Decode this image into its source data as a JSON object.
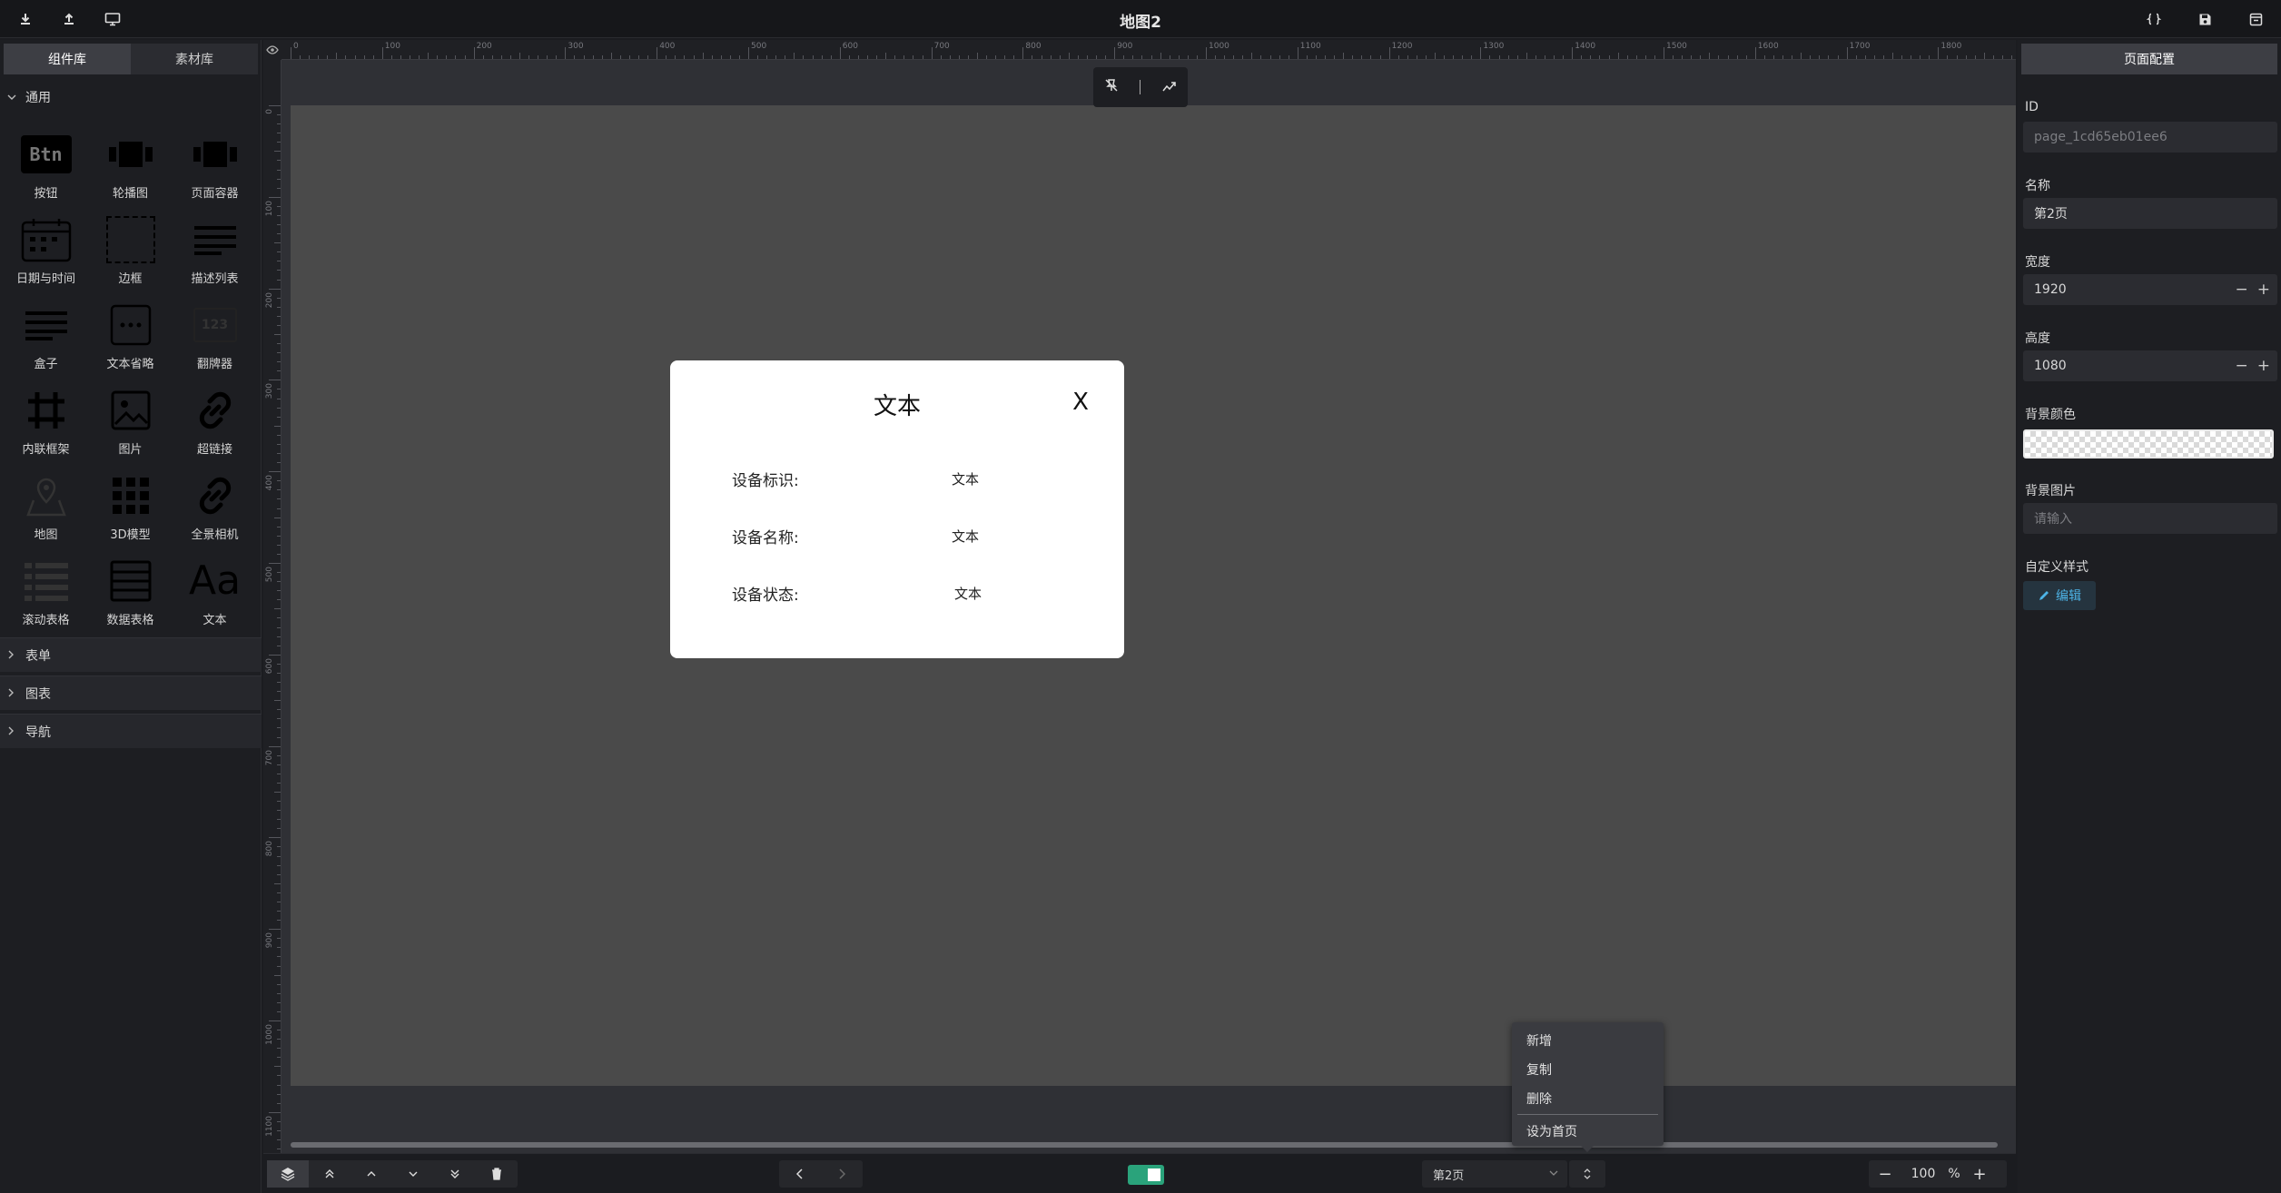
{
  "window": {
    "title": "地图2"
  },
  "left_panel": {
    "tabs": [
      {
        "label": "组件库"
      },
      {
        "label": "素材库"
      }
    ],
    "sections": {
      "general": "通用",
      "form": "表单",
      "charts": "图表",
      "nav": "导航"
    },
    "components": [
      {
        "label": "按钮",
        "icon": "button-icon"
      },
      {
        "label": "轮播图",
        "icon": "carousel-icon"
      },
      {
        "label": "页面容器",
        "icon": "page-container-icon"
      },
      {
        "label": "日期与时间",
        "icon": "calendar-icon"
      },
      {
        "label": "边框",
        "icon": "border-icon"
      },
      {
        "label": "描述列表",
        "icon": "description-list-icon"
      },
      {
        "label": "盒子",
        "icon": "box-icon"
      },
      {
        "label": "文本省略",
        "icon": "text-ellipsis-icon"
      },
      {
        "label": "翻牌器",
        "icon": "flip-counter-icon"
      },
      {
        "label": "内联框架",
        "icon": "iframe-icon"
      },
      {
        "label": "图片",
        "icon": "image-icon"
      },
      {
        "label": "超链接",
        "icon": "link-icon"
      },
      {
        "label": "地图",
        "icon": "map-icon"
      },
      {
        "label": "3D模型",
        "icon": "3d-model-icon"
      },
      {
        "label": "全景相机",
        "icon": "panorama-camera-icon"
      },
      {
        "label": "滚动表格",
        "icon": "scroll-table-icon"
      },
      {
        "label": "数据表格",
        "icon": "data-table-icon"
      },
      {
        "label": "文本",
        "icon": "text-icon"
      }
    ],
    "btn_icon_text": "Btn",
    "flip_icon_text": "123",
    "text_icon_text": "Aa"
  },
  "ruler": {
    "h_labels": [
      "0",
      "100",
      "200",
      "300",
      "400",
      "500",
      "600",
      "700",
      "800",
      "900",
      "1000",
      "1100",
      "1200",
      "1300",
      "1400",
      "1500",
      "1600",
      "1700",
      "1800"
    ],
    "v_labels": [
      "0",
      "100",
      "200",
      "300",
      "400",
      "500",
      "600",
      "700",
      "800",
      "900",
      "1000",
      "1100"
    ]
  },
  "modal": {
    "title": "文本",
    "close": "X",
    "rows": [
      {
        "label": "设备标识:",
        "value": "文本"
      },
      {
        "label": "设备名称:",
        "value": "文本"
      },
      {
        "label": "设备状态:",
        "value": "文本"
      }
    ]
  },
  "bottom_bar": {
    "page_select": "第2页",
    "zoom_value": "100",
    "zoom_unit": "%"
  },
  "context_menu": {
    "items": [
      "新增",
      "复制",
      "删除",
      "设为首页"
    ]
  },
  "right_panel": {
    "tab": "页面配置",
    "id_label": "ID",
    "id_value": "page_1cd65eb01ee6",
    "name_label": "名称",
    "name_value": "第2页",
    "width_label": "宽度",
    "width_value": "1920",
    "height_label": "高度",
    "height_value": "1080",
    "bg_color_label": "背景颜色",
    "bg_image_label": "背景图片",
    "bg_image_placeholder": "请输入",
    "custom_style_label": "自定义样式",
    "edit_label": "编辑"
  },
  "colors": {
    "accent": "#2aa37b",
    "link": "#4db3e6",
    "stage": "#4a4a4a",
    "panel": "#1d1e22"
  }
}
